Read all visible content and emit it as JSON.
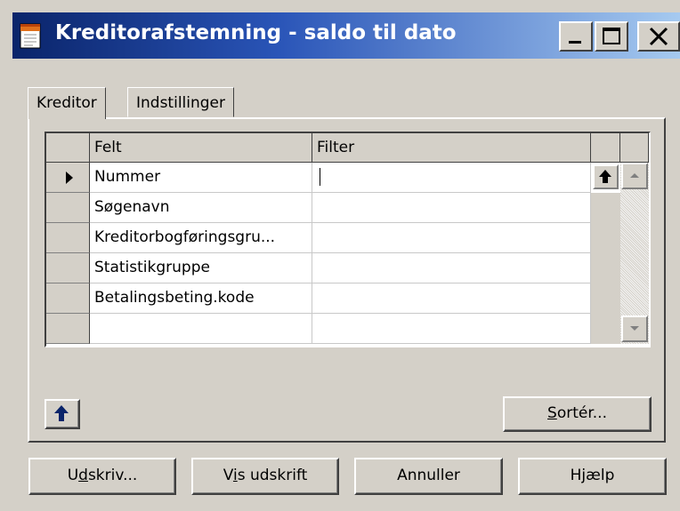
{
  "window": {
    "title": "Kreditorafstemning - saldo til dato",
    "controls": {
      "minimize": "_",
      "maximize": "□",
      "close": "X"
    }
  },
  "tabs": [
    {
      "label": "Kreditor",
      "active": true
    },
    {
      "label": "Indstillinger",
      "active": false
    }
  ],
  "grid": {
    "columns": [
      "Felt",
      "Filter"
    ],
    "rows": [
      {
        "field": "Nummer",
        "filter": "",
        "current": true
      },
      {
        "field": "Søgenavn",
        "filter": ""
      },
      {
        "field": "Kreditorbogføringsgru...",
        "filter": ""
      },
      {
        "field": "Statistikgruppe",
        "filter": ""
      },
      {
        "field": "Betalingsbeting.kode",
        "filter": ""
      },
      {
        "field": "",
        "filter": ""
      }
    ]
  },
  "panel": {
    "sort_button": {
      "pre": "",
      "mnemonic": "S",
      "post": "ortér..."
    }
  },
  "buttons": {
    "print": {
      "pre": "U",
      "mnemonic": "d",
      "post": "skriv..."
    },
    "preview": {
      "pre": "V",
      "mnemonic": "i",
      "post": "s udskrift"
    },
    "cancel": "Annuller",
    "help": "Hjælp"
  },
  "icons": {
    "app": "report-form-icon",
    "current_row": "row-pointer-icon",
    "field_lookup": "up-arrow-icon",
    "panel_action": "up-arrow-icon"
  },
  "colors": {
    "title_start": "#0a246a",
    "title_end": "#a6caf0",
    "face": "#d4d0c8",
    "arrow_blue": "#0a246a"
  }
}
